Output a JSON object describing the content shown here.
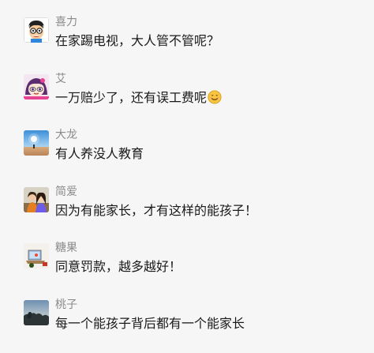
{
  "comments": [
    {
      "name": "喜力",
      "text": "在家踢电视，大人管不管呢？",
      "avatar": "cartoon-face-avatar"
    },
    {
      "name": "艾",
      "text": "一万赔少了，还有误工费呢",
      "avatar": "cartoon-girl-avatar",
      "emoji": "smiling-face-emoji"
    },
    {
      "name": "大龙",
      "text": "有人养没人教育",
      "avatar": "sky-landscape-avatar"
    },
    {
      "name": "简爱",
      "text": "因为有能家长，才有这样的能孩子！",
      "avatar": "couple-photo-avatar"
    },
    {
      "name": "糖果",
      "text": "同意罚款，越多越好！",
      "avatar": "desk-photo-avatar"
    },
    {
      "name": "桃子",
      "text": "每一个能孩子背后都有一个能家长",
      "avatar": "dusk-scenery-avatar"
    }
  ]
}
